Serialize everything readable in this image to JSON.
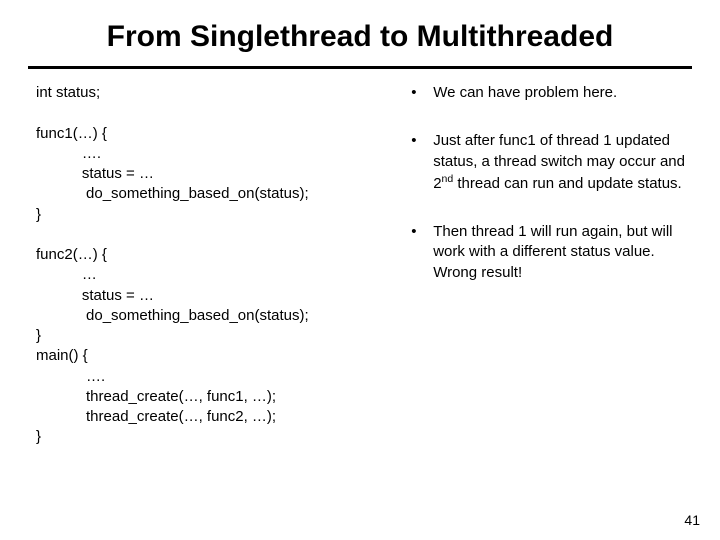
{
  "title": "From Singlethread to Multithreaded",
  "code": {
    "l1": "int status;",
    "l2": "",
    "l3": "func1(…) {",
    "l4": "           ….",
    "l5": "           status = …",
    "l6": "            do_something_based_on(status);",
    "l7": "}",
    "l8": "",
    "l9": "func2(…) {",
    "l10": "           …",
    "l11": "           status = …",
    "l12": "            do_something_based_on(status);",
    "l13": "}",
    "l14": "main() {",
    "l15": "            ….",
    "l16": "            thread_create(…, func1, …);",
    "l17": "            thread_create(…, func2, …);",
    "l18": "}"
  },
  "bullets": {
    "b1": "We can have problem here.",
    "b2a": "Just after func1 of thread 1 updated status, a thread switch may occur and 2",
    "b2sup": "nd",
    "b2b": " thread can run and update status.",
    "b3a": "Then thread 1 will run again, but will work with a different status value.",
    "b3b": " Wrong result!"
  },
  "pagenum": "41"
}
